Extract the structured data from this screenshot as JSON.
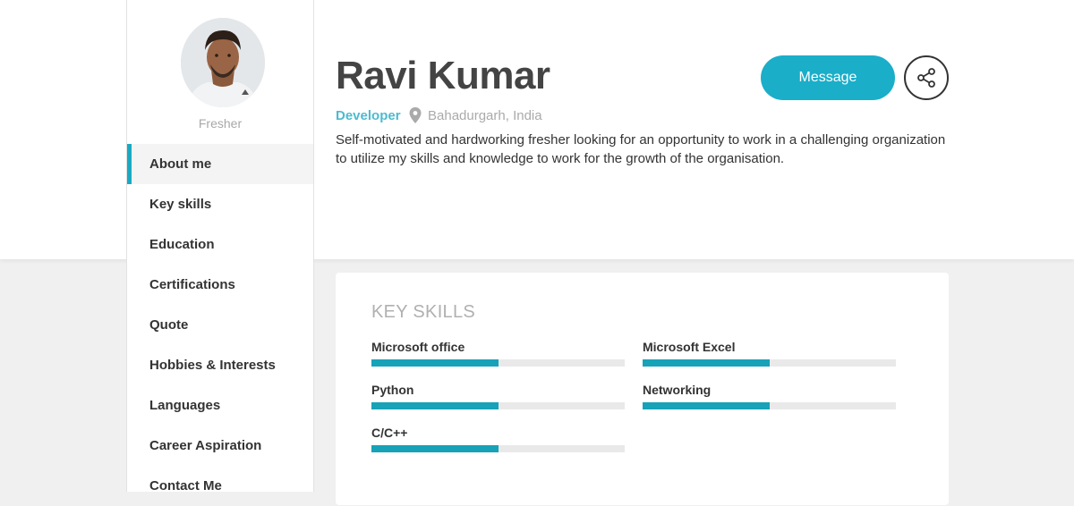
{
  "profile": {
    "status": "Fresher",
    "name": "Ravi Kumar",
    "role": "Developer",
    "location": "Bahadurgarh, India",
    "bio": "Self-motivated and hardworking fresher looking for an opportunity to work in a challenging organization to utilize my skills and knowledge to work for the growth of the organisation."
  },
  "actions": {
    "message_label": "Message",
    "share_icon": "share-icon"
  },
  "sidebar": {
    "items": [
      {
        "label": "About me",
        "active": true
      },
      {
        "label": "Key skills"
      },
      {
        "label": "Education"
      },
      {
        "label": "Certifications"
      },
      {
        "label": "Quote"
      },
      {
        "label": "Hobbies & Interests"
      },
      {
        "label": "Languages"
      },
      {
        "label": "Career Aspiration"
      },
      {
        "label": "Contact Me"
      }
    ]
  },
  "key_skills": {
    "title": "KEY SKILLS",
    "items": [
      {
        "name": "Microsoft office",
        "level": 0.5
      },
      {
        "name": "Microsoft Excel",
        "level": 0.5
      },
      {
        "name": "Python",
        "level": 0.5
      },
      {
        "name": "Networking",
        "level": 0.5
      },
      {
        "name": "C/C++",
        "level": 0.5
      }
    ]
  },
  "colors": {
    "accent": "#1aaec9",
    "skill_fill": "#17a2b8",
    "role_text": "#4dbbd0"
  }
}
